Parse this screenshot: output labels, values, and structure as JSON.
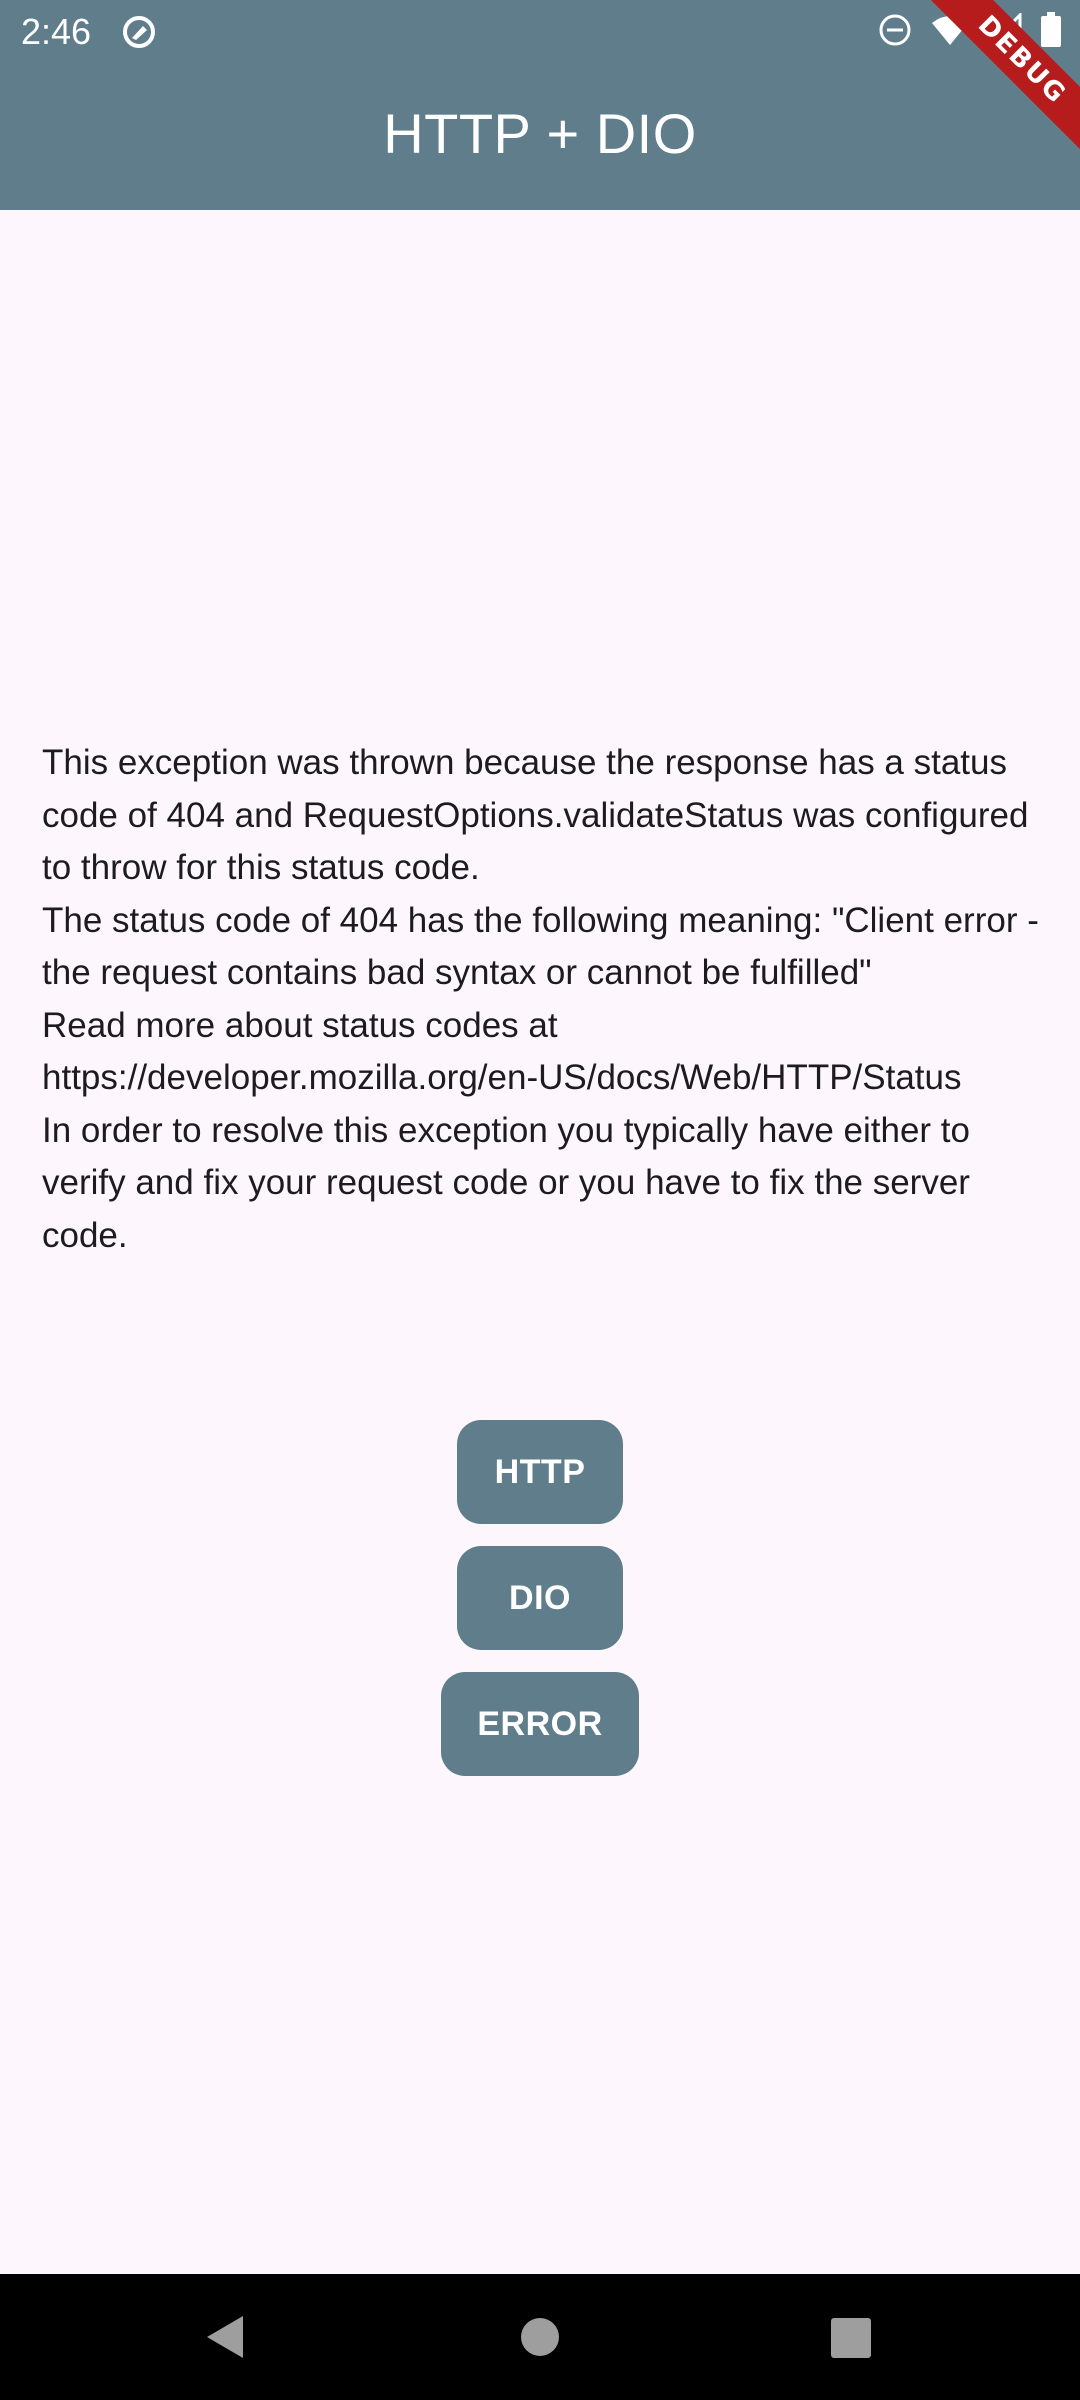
{
  "status_bar": {
    "time": "2:46",
    "icons": [
      "app-notification-icon",
      "do-not-disturb-icon",
      "wifi-icon",
      "signal-icon",
      "battery-icon"
    ]
  },
  "app_bar": {
    "title": "HTTP + DIO",
    "color": "#607D8B"
  },
  "debug_banner": {
    "label": "DEBUG",
    "color": "#B71C1C"
  },
  "message": {
    "text": "This exception was thrown because the response has a status code of 404 and RequestOptions.validateStatus was configured to throw for this status code.\nThe status code of 404 has the following meaning: \"Client error - the request contains bad syntax or cannot be fulfilled\"\nRead more about status codes at https://developer.mozilla.org/en-US/docs/Web/HTTP/Status\nIn order to resolve this exception you typically have either to verify and fix your request code or you have to fix the server code."
  },
  "buttons": {
    "http_label": "HTTP",
    "dio_label": "DIO",
    "error_label": "ERROR"
  },
  "colors": {
    "background": "#FDF7FD",
    "primary": "#607D8B",
    "text": "#1D1B20"
  },
  "navigation_bar": {
    "icons": [
      "back-icon",
      "home-icon",
      "recents-icon"
    ]
  }
}
